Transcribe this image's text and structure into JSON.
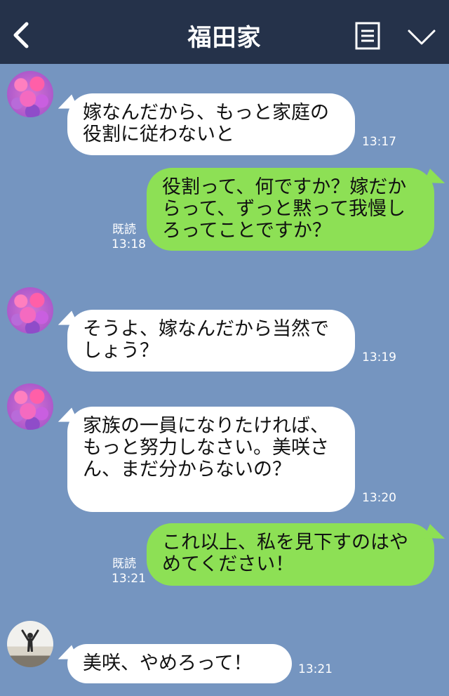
{
  "header": {
    "title": "福田家",
    "back_icon": "chevron-left-icon",
    "menu_icon": "notes-icon",
    "expand_icon": "chevron-down-icon"
  },
  "messages": [
    {
      "side": "left",
      "avatar": "flowers",
      "text": "嫁なんだから、もっと家庭の役割に従わないと",
      "time": "13:17",
      "read": ""
    },
    {
      "side": "right",
      "text": "役割って、何ですか？嫁だからって、ずっと黙って我慢しろってことですか？",
      "time": "13:18",
      "read": "既読"
    },
    {
      "side": "left",
      "avatar": "flowers",
      "text": "そうよ、嫁なんだから当然でしょう？",
      "time": "13:19",
      "read": ""
    },
    {
      "side": "left",
      "avatar": "flowers",
      "text": "家族の一員になりたければ、もっと努力しなさい。美咲さん、まだ分からないの？",
      "time": "13:20",
      "read": ""
    },
    {
      "side": "right",
      "text": "これ以上、私を見下すのはやめてください！",
      "time": "13:21",
      "read": "既読"
    },
    {
      "side": "left",
      "avatar": "person",
      "text": "美咲、やめろって！",
      "time": "13:21",
      "read": ""
    }
  ],
  "colors": {
    "background": "#7595c0",
    "header": "#25324a",
    "bubble_sent": "#8de055",
    "bubble_received": "#ffffff"
  }
}
